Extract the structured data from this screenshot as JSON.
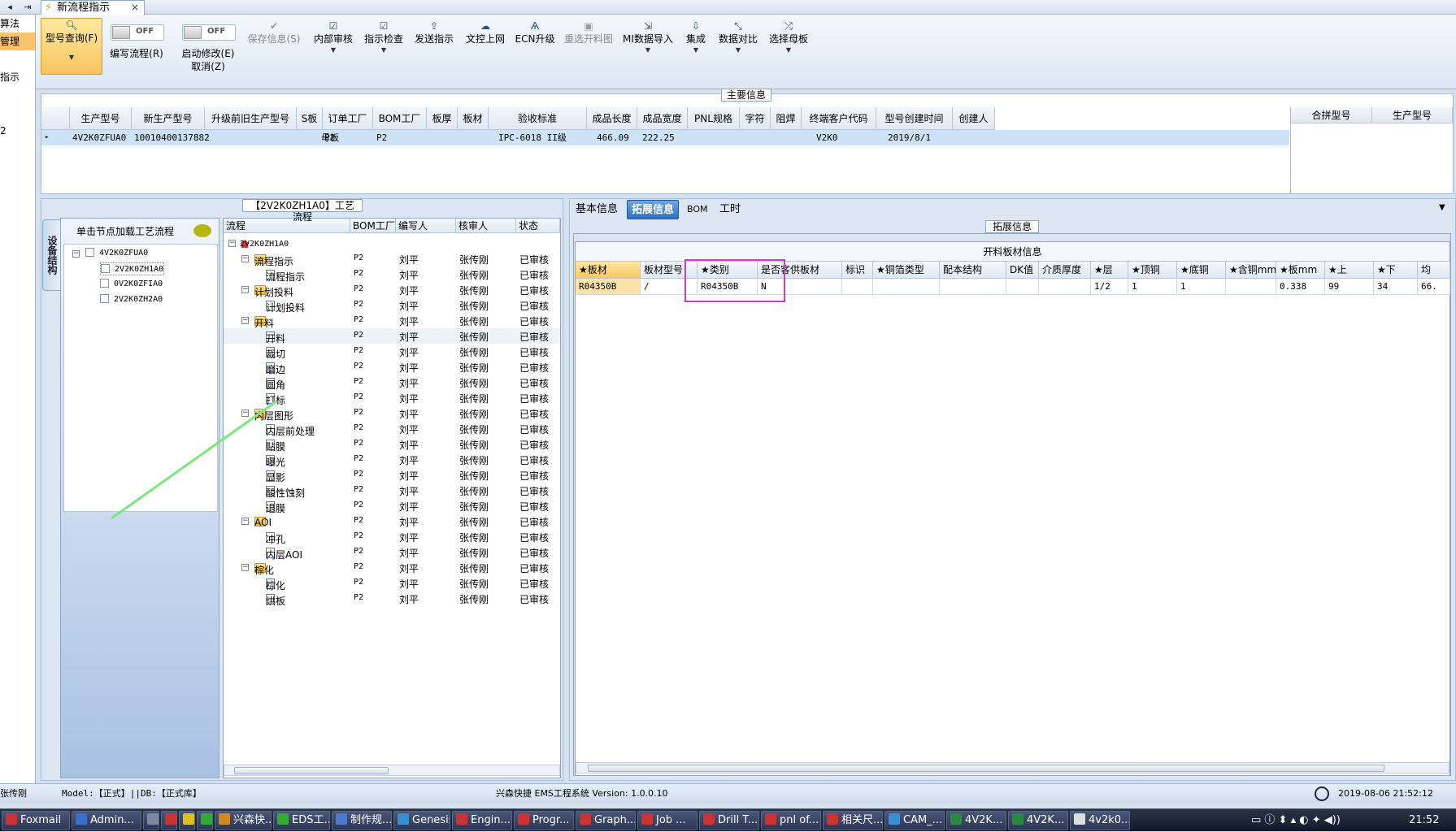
{
  "tabstrip": {
    "doc_tab_label": "新流程指示",
    "close": "×",
    "nav_left": "◂",
    "nav_right": "⇥"
  },
  "left_stub": [
    "算法",
    "管理",
    "",
    "指示",
    "",
    "",
    "2"
  ],
  "ribbon": {
    "type_query": "型号查询(F)",
    "edit_flow": "编写流程(R)",
    "toggle_text": "OFF",
    "start_modify": "启动修改(E)",
    "cancel": "取消(Z)",
    "save_info": "保存信息(S)",
    "internal_review": "内部审核",
    "instruction_check": "指示检查",
    "send_instruction": "发送指示",
    "upload": "文控上网",
    "ecn_upgrade": "ECN升级",
    "reselect_material_pic": "重选开料图",
    "mi_import": "MI数据导入",
    "integrate": "集成",
    "data_compare": "数据对比",
    "select_master": "选择母板"
  },
  "main_info": {
    "title": "主要信息",
    "columns": [
      "生产型号",
      "新生产型号",
      "升级前旧生产型号",
      "S板",
      "订单工厂",
      "BOM工厂",
      "板厚",
      "板材",
      "验收标准",
      "成品长度",
      "成品宽度",
      "PNL规格",
      "字符",
      "阻焊",
      "终端客户代码",
      "型号创建时间",
      "创建人"
    ],
    "row": {
      "prod_model": "4V2K0ZFUA0",
      "new_prod_model": "10010400137882",
      "old_model": "",
      "s_board": "母板",
      "order_factory": "P2",
      "bom_factory": "P2",
      "thickness": "",
      "material": "",
      "standard": "IPC-6018 II级",
      "length": "466.09",
      "width": "222.25",
      "pnl": "",
      "char": "",
      "solder": "",
      "customer": "V2K0",
      "created": "2019/8/1",
      "creator": ""
    },
    "right_columns": [
      "合拼型号",
      "生产型号"
    ],
    "row_marker": "▸"
  },
  "process": {
    "title": "【2V2K0ZH1A0】工艺流程",
    "vertical_tab": "设备结构",
    "node_header": "单击节点加载工艺流程",
    "nodes": [
      "4V2K0ZFUA0",
      "2V2K0ZH1A0",
      "0V2K0ZFIA0",
      "2V2K0ZH2A0"
    ],
    "columns": [
      "流程",
      "BOM工厂",
      "编写人",
      "核审人",
      "状态"
    ],
    "root": "2V2K0ZH1A0",
    "rows": [
      {
        "name": "流程指示",
        "type": "folder",
        "bom": "P2",
        "writer": "刘平",
        "reviewer": "张传刚",
        "status": "已审核"
      },
      {
        "name": "流程指示",
        "type": "doc",
        "bom": "P2",
        "writer": "刘平",
        "reviewer": "张传刚",
        "status": "已审核"
      },
      {
        "name": "计划投料",
        "type": "folder",
        "bom": "P2",
        "writer": "刘平",
        "reviewer": "张传刚",
        "status": "已审核"
      },
      {
        "name": "计划投料",
        "type": "doc",
        "bom": "P2",
        "writer": "刘平",
        "reviewer": "张传刚",
        "status": "已审核"
      },
      {
        "name": "开料",
        "type": "folder",
        "bom": "P2",
        "writer": "刘平",
        "reviewer": "张传刚",
        "status": "已审核"
      },
      {
        "name": "开料",
        "type": "doc",
        "bom": "P2",
        "writer": "刘平",
        "reviewer": "张传刚",
        "status": "已审核"
      },
      {
        "name": "裁切",
        "type": "doc",
        "bom": "P2",
        "writer": "刘平",
        "reviewer": "张传刚",
        "status": "已审核"
      },
      {
        "name": "磨边",
        "type": "doc",
        "bom": "P2",
        "writer": "刘平",
        "reviewer": "张传刚",
        "status": "已审核"
      },
      {
        "name": "圆角",
        "type": "doc",
        "bom": "P2",
        "writer": "刘平",
        "reviewer": "张传刚",
        "status": "已审核"
      },
      {
        "name": "打标",
        "type": "doc",
        "bom": "P2",
        "writer": "刘平",
        "reviewer": "张传刚",
        "status": "已审核"
      },
      {
        "name": "内层图形",
        "type": "folder",
        "bom": "P2",
        "writer": "刘平",
        "reviewer": "张传刚",
        "status": "已审核"
      },
      {
        "name": "内层前处理",
        "type": "doc",
        "bom": "P2",
        "writer": "刘平",
        "reviewer": "张传刚",
        "status": "已审核"
      },
      {
        "name": "贴膜",
        "type": "doc",
        "bom": "P2",
        "writer": "刘平",
        "reviewer": "张传刚",
        "status": "已审核"
      },
      {
        "name": "曝光",
        "type": "doc",
        "bom": "P2",
        "writer": "刘平",
        "reviewer": "张传刚",
        "status": "已审核"
      },
      {
        "name": "显影",
        "type": "doc",
        "bom": "P2",
        "writer": "刘平",
        "reviewer": "张传刚",
        "status": "已审核"
      },
      {
        "name": "酸性蚀刻",
        "type": "doc",
        "bom": "P2",
        "writer": "刘平",
        "reviewer": "张传刚",
        "status": "已审核"
      },
      {
        "name": "退膜",
        "type": "doc",
        "bom": "P2",
        "writer": "刘平",
        "reviewer": "张传刚",
        "status": "已审核"
      },
      {
        "name": "AOI",
        "type": "folder",
        "bom": "P2",
        "writer": "刘平",
        "reviewer": "张传刚",
        "status": "已审核"
      },
      {
        "name": "冲孔",
        "type": "doc",
        "bom": "P2",
        "writer": "刘平",
        "reviewer": "张传刚",
        "status": "已审核"
      },
      {
        "name": "内层AOI",
        "type": "doc",
        "bom": "P2",
        "writer": "刘平",
        "reviewer": "张传刚",
        "status": "已审核"
      },
      {
        "name": "棕化",
        "type": "folder",
        "bom": "P2",
        "writer": "刘平",
        "reviewer": "张传刚",
        "status": "已审核"
      },
      {
        "name": "棕化",
        "type": "doc",
        "bom": "P2",
        "writer": "刘平",
        "reviewer": "张传刚",
        "status": "已审核"
      },
      {
        "name": "烘板",
        "type": "doc",
        "bom": "P2",
        "writer": "刘平",
        "reviewer": "张传刚",
        "status": "已审核"
      }
    ]
  },
  "right": {
    "tabs": [
      "基本信息",
      "拓展信息",
      "BOM",
      "工时"
    ],
    "ext_title": "拓展信息",
    "material_title": "开料板材信息",
    "columns": [
      "★板材",
      "板材型号",
      "★类别",
      "是否客供板材",
      "标识",
      "★铜箔类型",
      "配本结构",
      "DK值",
      "介质厚度",
      "★层",
      "★顶铜",
      "★底铜",
      "★含铜mm",
      "★板mm",
      "★上",
      "★下",
      "均"
    ],
    "row": [
      "R04350B",
      "/",
      "R04350B",
      "N",
      "",
      "",
      "",
      "",
      "",
      "1/2",
      "1",
      "1",
      "",
      "0.338",
      "99",
      "34",
      "66."
    ]
  },
  "statusbar": {
    "user": "张传刚",
    "model": "Model:【正式】||DB:【正式库】",
    "system": "兴森快捷 EMS工程系统 Version: 1.0.0.10",
    "datetime": "2019-08-06 21:52:12"
  },
  "taskbar": {
    "items": [
      "Foxmail",
      "Admin...",
      "",
      "",
      "",
      "",
      "兴森快...",
      "EDS工...",
      "制作规...",
      "Genesis",
      "Engin...",
      "Progr...",
      "Graph...",
      "Job ...",
      "Drill T...",
      "pnl of...",
      "相关尺...",
      "CAM_...",
      "4V2K...",
      "4V2K...",
      "4v2k0..."
    ],
    "time": "21:52"
  }
}
